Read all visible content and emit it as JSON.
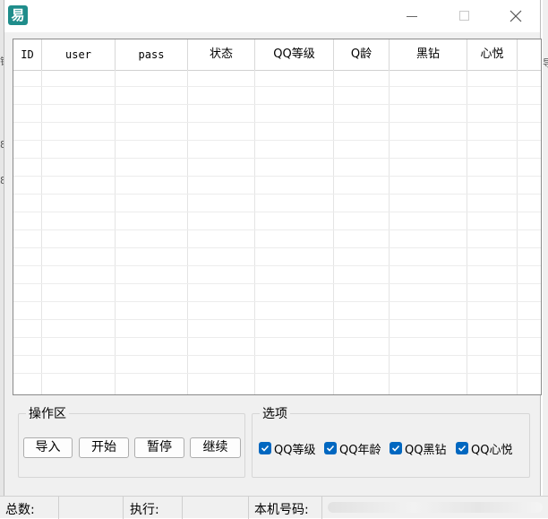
{
  "window": {
    "app_icon_glyph": "易"
  },
  "table": {
    "columns": [
      "ID",
      "user",
      "pass",
      "状态",
      "QQ等级",
      "Q龄",
      "黑钻",
      "心悦"
    ]
  },
  "operations": {
    "legend": "操作区",
    "buttons": [
      "导入",
      "开始",
      "暂停",
      "继续"
    ]
  },
  "options": {
    "legend": "选项",
    "checkboxes": [
      {
        "label": "QQ等级",
        "checked": true
      },
      {
        "label": "QQ年龄",
        "checked": true
      },
      {
        "label": "QQ黑钻",
        "checked": true
      },
      {
        "label": "QQ心悦",
        "checked": true
      }
    ]
  },
  "statusbar": {
    "total_label": "总数:",
    "exec_label": "执行:",
    "phone_label": "本机号码:"
  },
  "background": {
    "left_fragments": [
      "错",
      "8",
      "8"
    ],
    "right_fragments": [
      "导"
    ]
  },
  "colors": {
    "checkbox_accent": "#0067c0",
    "app_icon": "#1f8d8b"
  }
}
